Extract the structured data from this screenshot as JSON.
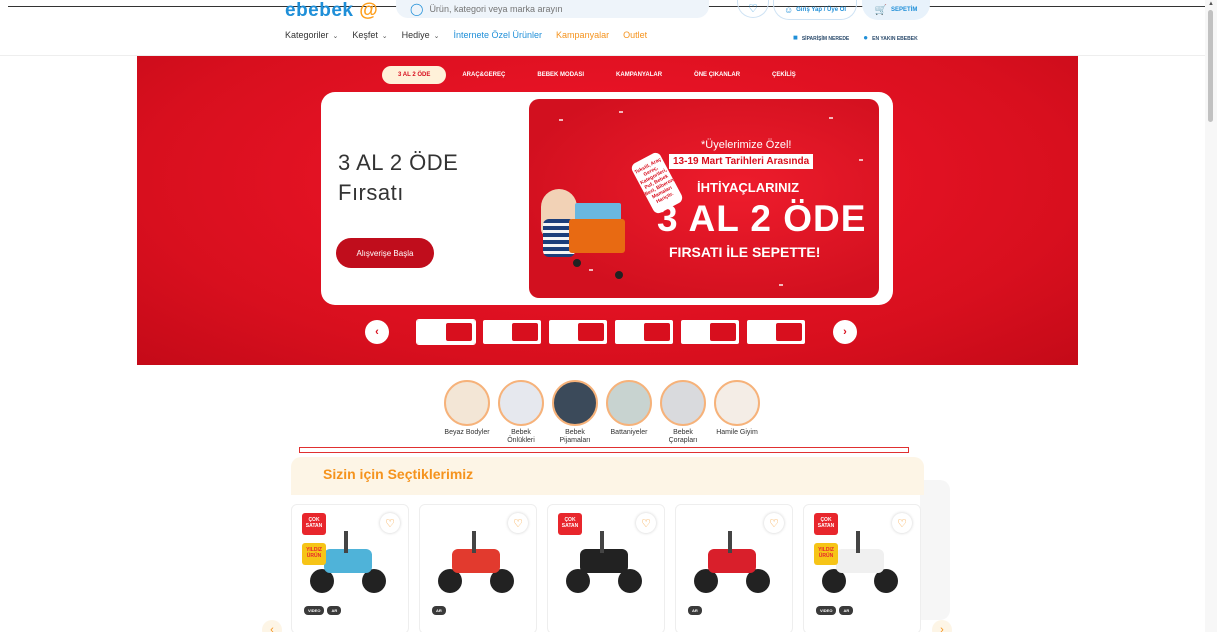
{
  "header": {
    "logo": "ebebek",
    "search_placeholder": "Ürün, kategori veya marka arayın",
    "login_label": "Giriş Yap / Üye Ol",
    "cart_label": "SEPETİM",
    "nav": [
      {
        "label": "Kategoriler",
        "chevron": true,
        "style": "default"
      },
      {
        "label": "Keşfet",
        "chevron": true,
        "style": "default"
      },
      {
        "label": "Hediye",
        "chevron": true,
        "style": "default"
      },
      {
        "label": "İnternete Özel Ürünler",
        "chevron": false,
        "style": "blue"
      },
      {
        "label": "Kampanyalar",
        "chevron": false,
        "style": "orange"
      },
      {
        "label": "Outlet",
        "chevron": false,
        "style": "orange"
      }
    ],
    "right_links": [
      "SİPARİŞİM NEREDE",
      "EN YAKIN EBEBEK"
    ]
  },
  "hero": {
    "tabs": [
      "3 AL 2 ÖDE",
      "ARAÇ&GEREÇ",
      "BEBEK MODASI",
      "KAMPANYALAR",
      "ÖNE ÇIKANLAR",
      "ÇEKİLİŞ"
    ],
    "active_tab": 0,
    "title_line1": "3 AL 2 ÖDE",
    "title_line2": "Fırsatı",
    "cta": "Alışverişe Başla",
    "banner": {
      "line1": "*Üyelerimize Özel!",
      "line2": "13-19 Mart Tarihleri Arasında",
      "line3": "İHTİYAÇLARINIZ",
      "line4": "3 AL 2 ÖDE",
      "line5": "FIRSATI İLE SEPETTE!",
      "badge": "Tekstil, Araç Gereç, Kategorileri, Puf, Bebek Bezi, Biberon Mamaları Hariçtir."
    },
    "thumbnail_count": 6,
    "prev_arrow": "‹",
    "next_arrow": "›"
  },
  "categories": [
    {
      "label": "Beyaz Bodyler",
      "color": "#f3e6d6"
    },
    {
      "label": "Bebek Önlükleri",
      "color": "#e6e8ee"
    },
    {
      "label": "Bebek Pijamaları",
      "color": "#3b4a5a"
    },
    {
      "label": "Battaniyeler",
      "color": "#c8d3d0"
    },
    {
      "label": "Bebek Çorapları",
      "color": "#d9dadd"
    },
    {
      "label": "Hamile Giyim",
      "color": "#f4ede6"
    }
  ],
  "recommendations": {
    "title": "Sizin için Seçtiklerimiz",
    "products": [
      {
        "tags": [
          "VIDEO",
          "AR"
        ],
        "sticker_top": "ÇOK SATAN",
        "sticker_bottom": "YILDIZ ÜRÜN",
        "color": "#4fb3d9"
      },
      {
        "tags": [
          "AR"
        ],
        "sticker_top": "",
        "sticker_bottom": "",
        "color": "#e23a2e"
      },
      {
        "tags": [],
        "sticker_top": "ÇOK SATAN",
        "sticker_bottom": "",
        "color": "#222222"
      },
      {
        "tags": [
          "AR"
        ],
        "sticker_top": "",
        "sticker_bottom": "",
        "color": "#d91f2b"
      },
      {
        "tags": [
          "VIDEO",
          "AR"
        ],
        "sticker_top": "ÇOK SATAN",
        "sticker_bottom": "YILDIZ ÜRÜN",
        "color": "#f0f0f0"
      }
    ]
  },
  "colors": {
    "brand_blue": "#1f8fd8",
    "brand_orange": "#f5931d",
    "hero_red": "#d80f1e"
  }
}
